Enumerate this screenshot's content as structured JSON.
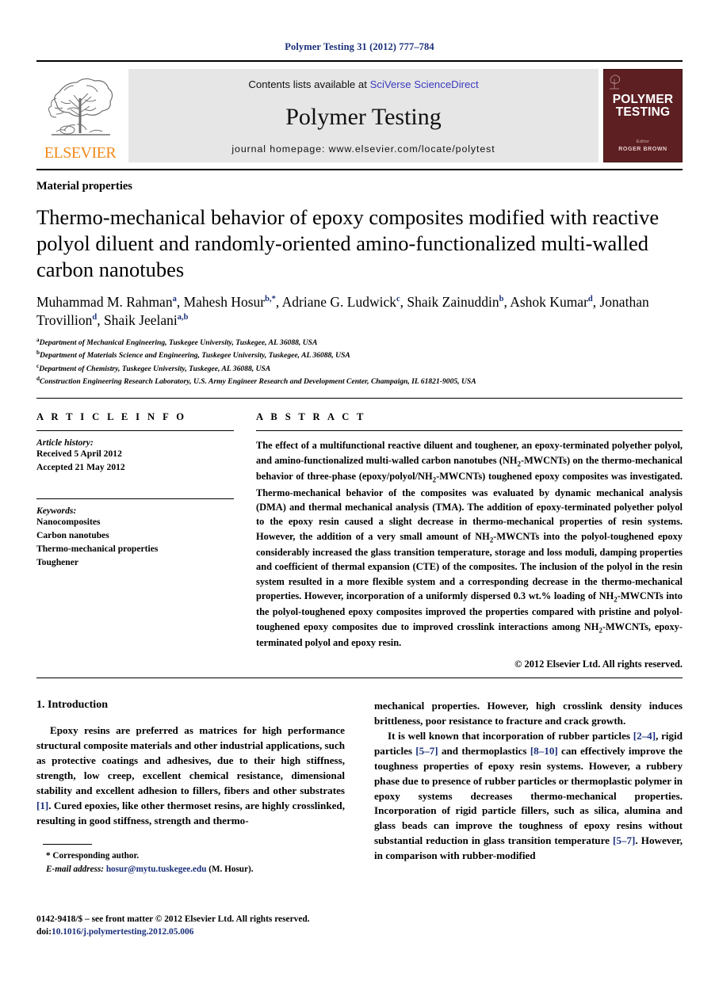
{
  "running_head": "Polymer Testing 31 (2012) 777–784",
  "masthead": {
    "contents_prefix": "Contents lists available at ",
    "sciencedirect_link": "SciVerse ScienceDirect",
    "journal_name": "Polymer Testing",
    "homepage": "journal homepage: www.elsevier.com/locate/polytest",
    "publisher_wordmark": "ELSEVIER",
    "cover": {
      "title_line1": "POLYMER",
      "title_line2": "TESTING",
      "editor_label": "Editor",
      "editor_name": "ROGER BROWN"
    }
  },
  "article": {
    "kicker": "Material properties",
    "title": "Thermo-mechanical behavior of epoxy composites modified with reactive polyol diluent and randomly-oriented amino-functionalized multi-walled carbon nanotubes",
    "authors": [
      {
        "name": "Muhammad M. Rahman",
        "marks": "a",
        "sep": ", "
      },
      {
        "name": "Mahesh Hosur",
        "marks": "b,*",
        "sep": ", "
      },
      {
        "name": "Adriane G. Ludwick",
        "marks": "c",
        "sep": ", "
      },
      {
        "name": "Shaik Zainuddin",
        "marks": "b",
        "sep": ", "
      },
      {
        "name": "Ashok Kumar",
        "marks": "d",
        "sep": ", "
      },
      {
        "name": "Jonathan Trovillion",
        "marks": "d",
        "sep": ", "
      },
      {
        "name": "Shaik Jeelani",
        "marks": "a,b",
        "sep": ""
      }
    ],
    "affiliations": [
      {
        "mark": "a",
        "text": "Department of Mechanical Engineering, Tuskegee University, Tuskegee, AL 36088, USA"
      },
      {
        "mark": "b",
        "text": "Department of Materials Science and Engineering, Tuskegee University, Tuskegee, AL 36088, USA"
      },
      {
        "mark": "c",
        "text": "Department of Chemistry, Tuskegee University, Tuskegee, AL 36088, USA"
      },
      {
        "mark": "d",
        "text": "Construction Engineering Research Laboratory, U.S. Army Engineer Research and Development Center, Champaign, IL 61821-9005, USA"
      }
    ]
  },
  "article_info": {
    "heading": "A R T I C L E  I N F O",
    "history_label": "Article history:",
    "received": "Received 5 April 2012",
    "accepted": "Accepted 21 May 2012",
    "keywords_label": "Keywords:",
    "keywords": [
      "Nanocomposites",
      "Carbon nanotubes",
      "Thermo-mechanical properties",
      "Toughener"
    ]
  },
  "abstract": {
    "heading": "A B S T R A C T",
    "copyright": "© 2012 Elsevier Ltd. All rights reserved."
  },
  "intro": {
    "heading": "1. Introduction",
    "footnote_corresponding": "* Corresponding author.",
    "footnote_email_label": "E-mail address:",
    "footnote_email": "hosur@mytu.tuskegee.edu",
    "footnote_email_suffix": " (M. Hosur)."
  },
  "footer": {
    "front_matter": "0142-9418/$ – see front matter © 2012 Elsevier Ltd. All rights reserved.",
    "doi_label": "doi:",
    "doi": "10.1016/j.polymertesting.2012.05.006"
  },
  "colors": {
    "link_blue": "#1a2f7a",
    "sciencedirect_blue": "#3b3bbf",
    "elsevier_orange": "#f08a1b",
    "cover_maroon": "#5d1f22",
    "banner_gray": "#e6e6e6"
  }
}
